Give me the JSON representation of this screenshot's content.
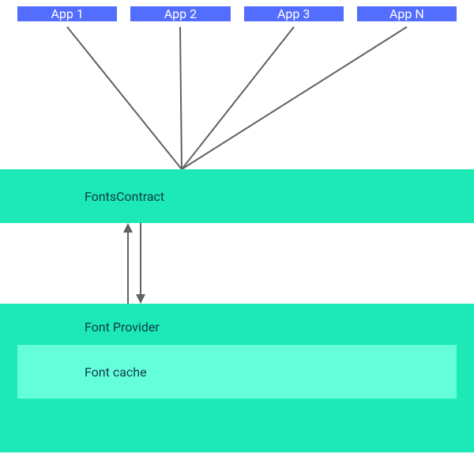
{
  "apps": [
    "App 1",
    "App 2",
    "App 3",
    "App N"
  ],
  "fonts_contract": "FontsContract",
  "font_provider": "Font Provider",
  "font_cache": "Font cache"
}
